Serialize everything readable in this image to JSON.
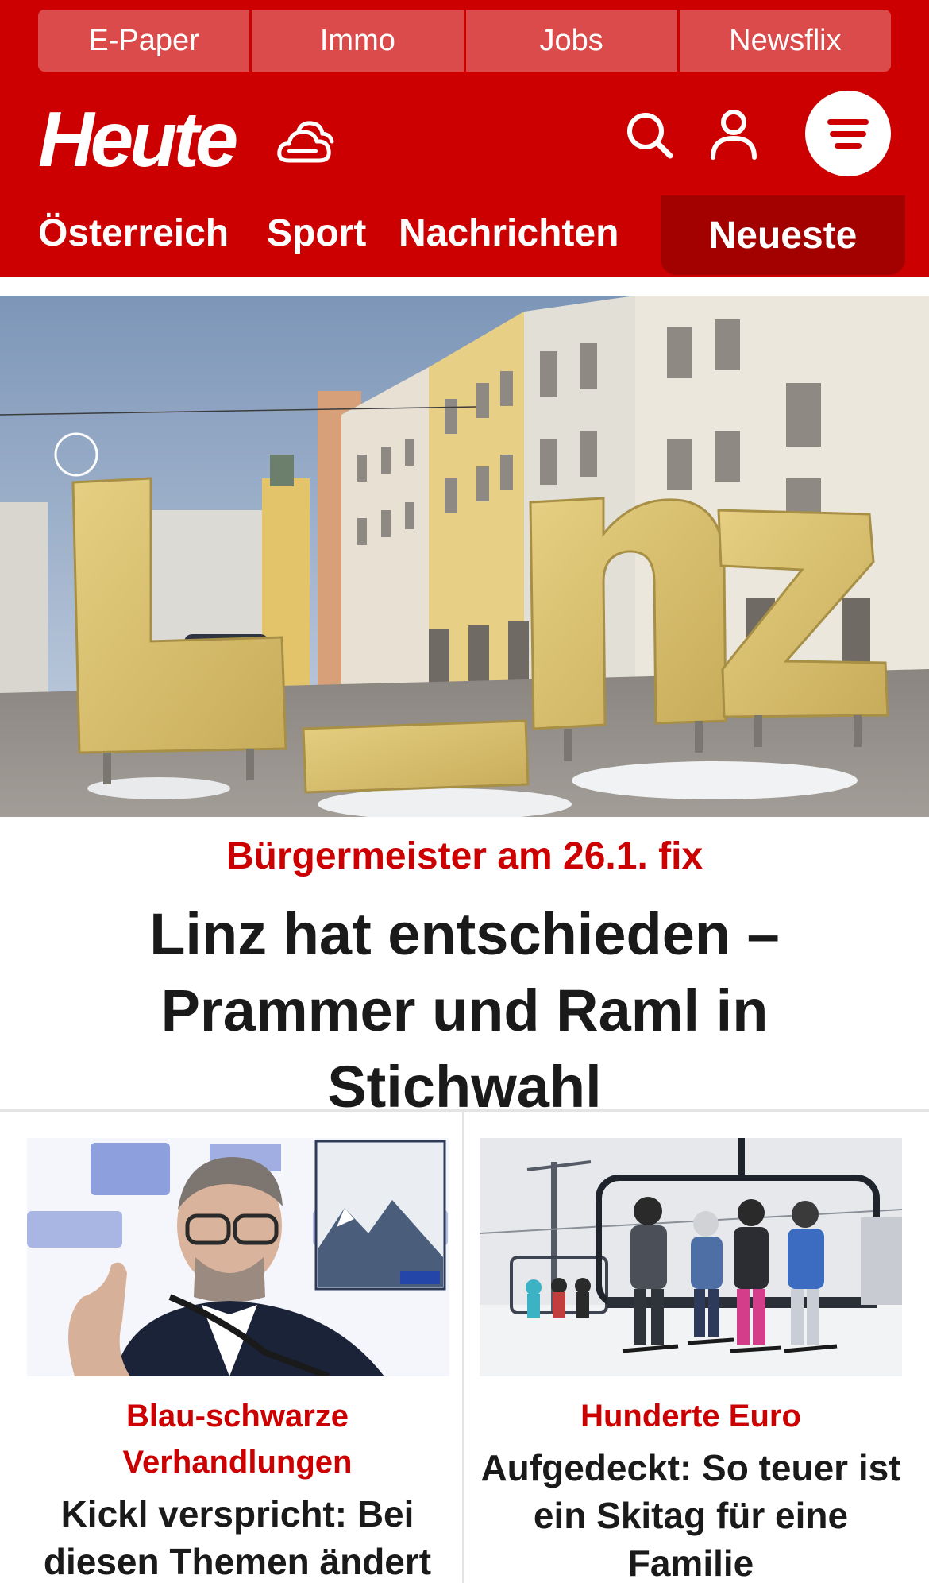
{
  "service_bar": {
    "items": [
      "E-Paper",
      "Immo",
      "Jobs",
      "Newsflix"
    ]
  },
  "logo": {
    "text": "Heute"
  },
  "icons": {
    "weather": "weather-icon",
    "search": "search-icon",
    "user": "user-icon",
    "menu": "menu-icon"
  },
  "nav": {
    "items": [
      "Österreich",
      "Sport",
      "Nachrichten"
    ],
    "highlight": "Neueste"
  },
  "hero": {
    "kicker": "Bürgermeister am 26.1. fix",
    "title": "Linz hat entschieden – Prammer und Raml in Stichwahl"
  },
  "teasers": [
    {
      "kicker": "Blau-schwarze Verhandlungen",
      "title": "Kickl verspricht: Bei diesen Themen ändert"
    },
    {
      "kicker": "Hunderte Euro",
      "title": "Aufgedeckt: So teuer ist ein Skitag für eine Familie"
    }
  ],
  "colors": {
    "brand_red": "#cc0000",
    "service_item": "#dc4b4b",
    "nav_active": "#a30000",
    "text_dark": "#1a1a1a"
  }
}
